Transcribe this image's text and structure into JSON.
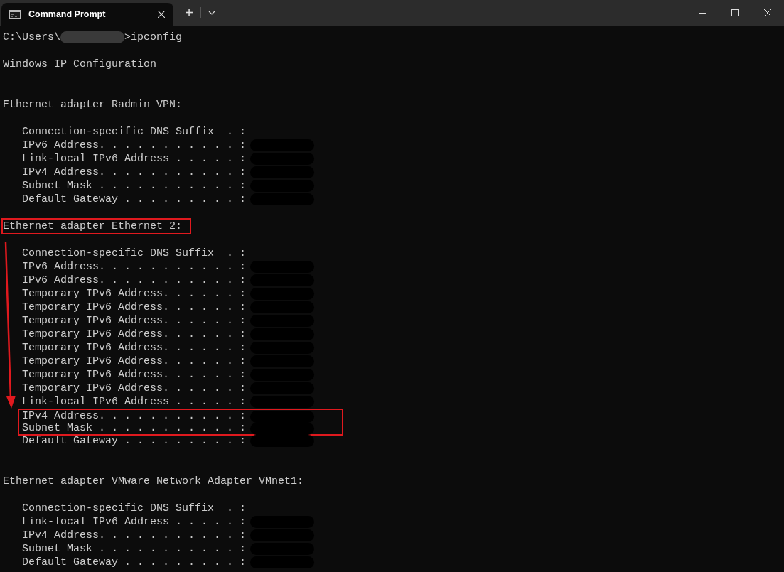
{
  "window": {
    "tabs": [
      {
        "title": "Command Prompt",
        "selected": true
      }
    ],
    "new_tab": "+"
  },
  "terminal": {
    "lines": [
      {
        "kind": "prompt",
        "path": "C:\\Users\\",
        "command": ">ipconfig"
      },
      {
        "kind": "blank"
      },
      {
        "kind": "text",
        "text": "Windows IP Configuration"
      },
      {
        "kind": "blank"
      },
      {
        "kind": "blank"
      },
      {
        "kind": "text",
        "text": "Ethernet adapter Radmin VPN:",
        "children": [
          {
            "kind": "blank"
          },
          {
            "kind": "text",
            "text": "Connection-specific DNS Suffix  . :"
          },
          {
            "kind": "text",
            "text": "IPv6 Address. . . . . . . . . . . :",
            "redacted": true
          },
          {
            "kind": "text",
            "text": "Link-local IPv6 Address . . . . . :",
            "redacted": true
          },
          {
            "kind": "text",
            "text": "IPv4 Address. . . . . . . . . . . :",
            "redacted": true
          },
          {
            "kind": "text",
            "text": "Subnet Mask . . . . . . . . . . . :",
            "redacted": true
          },
          {
            "kind": "text",
            "text": "Default Gateway . . . . . . . . . :",
            "redacted": true
          },
          {
            "kind": "blank"
          }
        ]
      },
      {
        "kind": "text",
        "text": "Ethernet adapter Ethernet 2:",
        "highlighted": true,
        "children": [
          {
            "kind": "blank"
          },
          {
            "kind": "text",
            "text": "Connection-specific DNS Suffix  . :"
          },
          {
            "kind": "text",
            "text": "IPv6 Address. . . . . . . . . . . :",
            "redacted": true
          },
          {
            "kind": "text",
            "text": "IPv6 Address. . . . . . . . . . . :",
            "redacted": true
          },
          {
            "kind": "text",
            "text": "Temporary IPv6 Address. . . . . . :",
            "redacted": true
          },
          {
            "kind": "text",
            "text": "Temporary IPv6 Address. . . . . . :",
            "redacted": true
          },
          {
            "kind": "text",
            "text": "Temporary IPv6 Address. . . . . . :",
            "redacted": true
          },
          {
            "kind": "text",
            "text": "Temporary IPv6 Address. . . . . . :",
            "redacted": true
          },
          {
            "kind": "text",
            "text": "Temporary IPv6 Address. . . . . . :",
            "redacted": true
          },
          {
            "kind": "text",
            "text": "Temporary IPv6 Address. . . . . . :",
            "redacted": true
          },
          {
            "kind": "text",
            "text": "Temporary IPv6 Address. . . . . . :",
            "redacted": true
          },
          {
            "kind": "text",
            "text": "Temporary IPv6 Address. . . . . . :",
            "redacted": true
          },
          {
            "kind": "text",
            "text": "Link-local IPv6 Address . . . . . :",
            "redacted": true
          },
          {
            "kind": "text",
            "text": "IPv4 Address. . . . . . . . . . . :",
            "redacted": true,
            "highlighted": true
          },
          {
            "kind": "text",
            "text": "Subnet Mask . . . . . . . . . . . :",
            "redacted": true,
            "highlighted": true
          },
          {
            "kind": "text",
            "text": "Default Gateway . . . . . . . . . :",
            "redacted": true
          },
          {
            "kind": "blank"
          },
          {
            "kind": "blank"
          }
        ]
      },
      {
        "kind": "text",
        "text": "Ethernet adapter VMware Network Adapter VMnet1:",
        "children": [
          {
            "kind": "blank"
          },
          {
            "kind": "text",
            "text": "Connection-specific DNS Suffix  . :"
          },
          {
            "kind": "text",
            "text": "Link-local IPv6 Address . . . . . :",
            "redacted": true
          },
          {
            "kind": "text",
            "text": "IPv4 Address. . . . . . . . . . . :",
            "redacted": true
          },
          {
            "kind": "text",
            "text": "Subnet Mask . . . . . . . . . . . :",
            "redacted": true
          },
          {
            "kind": "text",
            "text": "Default Gateway . . . . . . . . . :",
            "redacted": true
          }
        ]
      }
    ]
  }
}
